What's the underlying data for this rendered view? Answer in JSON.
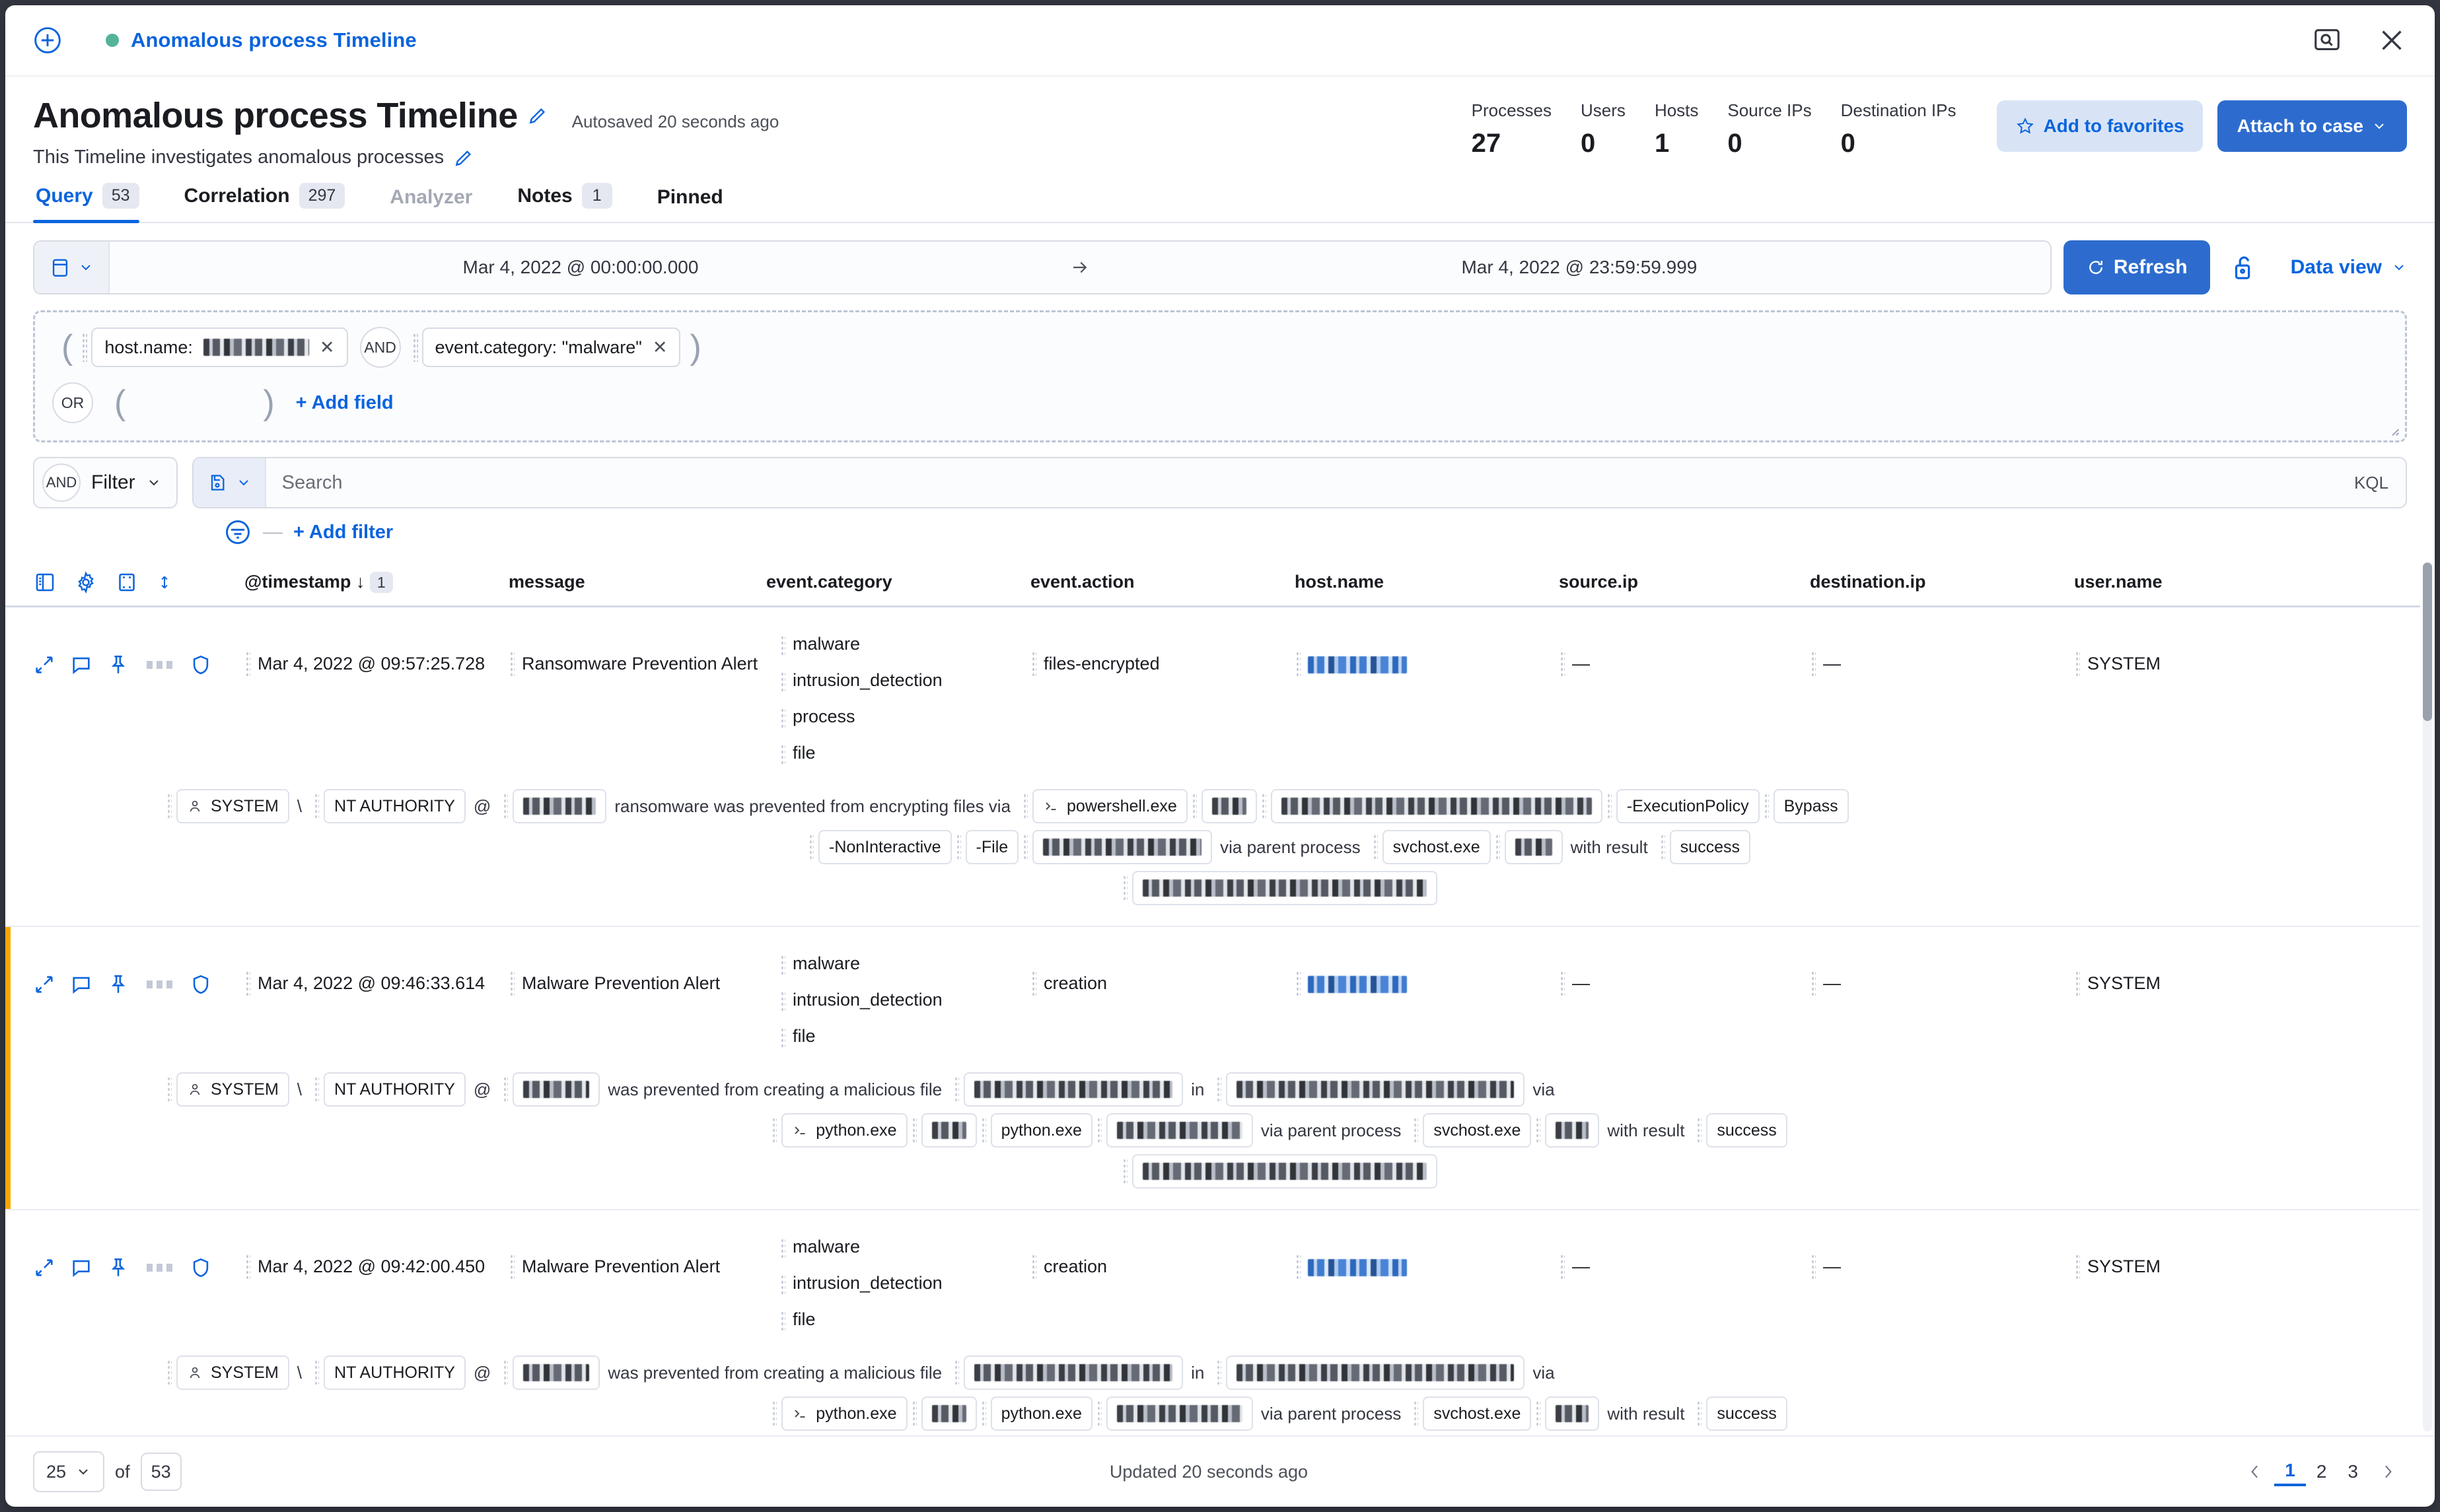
{
  "topstrip": {
    "add_icon": "plus-in-circle-icon",
    "status_dot_color": "#54b399",
    "timeline_name": "Anomalous process Timeline",
    "inspect_icon": "inspect-icon",
    "close_icon": "close-icon"
  },
  "header": {
    "title": "Anomalous process Timeline",
    "autosaved": "Autosaved 20 seconds ago",
    "description": "This Timeline investigates anomalous processes",
    "edit_icon": "pencil-icon",
    "stats": [
      {
        "label": "Processes",
        "value": "27"
      },
      {
        "label": "Users",
        "value": "0"
      },
      {
        "label": "Hosts",
        "value": "1"
      },
      {
        "label": "Source IPs",
        "value": "0"
      },
      {
        "label": "Destination IPs",
        "value": "0"
      }
    ],
    "favorites_label": "Add to favorites",
    "attach_label": "Attach to case"
  },
  "tabs": [
    {
      "label": "Query",
      "badge": "53",
      "state": "active"
    },
    {
      "label": "Correlation",
      "badge": "297",
      "state": "normal"
    },
    {
      "label": "Analyzer",
      "badge": "",
      "state": "disabled"
    },
    {
      "label": "Notes",
      "badge": "1",
      "state": "normal"
    },
    {
      "label": "Pinned",
      "badge": "",
      "state": "normal"
    }
  ],
  "toolbar": {
    "start_date": "Mar 4, 2022 @ 00:00:00.000",
    "end_date": "Mar 4, 2022 @ 23:59:59.999",
    "refresh_label": "Refresh",
    "dataview_label": "Data view",
    "calendar_icon": "calendar-icon",
    "lock_icon": "unlock-icon"
  },
  "query_builder": {
    "row1": {
      "field1_label": "host.name:",
      "field1_value_redacted": true,
      "operator": "AND",
      "field2_label": "event.category: \"malware\"",
      "remove_glyph": "✕"
    },
    "row2": {
      "operator": "OR",
      "add_field_label": "+ Add field"
    }
  },
  "filterbar": {
    "operator": "AND",
    "filter_label": "Filter",
    "search_placeholder": "Search",
    "search_value": "",
    "language_label": "KQL",
    "add_filter_label": "+ Add filter",
    "save_icon": "saved-query-icon",
    "filter_icon": "filter-icon"
  },
  "table": {
    "header_icons": [
      "columns-icon",
      "settings-gear-icon",
      "fullscreen-icon",
      "sort-icon"
    ],
    "columns": [
      {
        "key": "timestamp",
        "label": "@timestamp",
        "sort_glyph": "↓",
        "sort_badge": "1"
      },
      {
        "key": "message",
        "label": "message"
      },
      {
        "key": "event_category",
        "label": "event.category"
      },
      {
        "key": "event_action",
        "label": "event.action"
      },
      {
        "key": "host_name",
        "label": "host.name"
      },
      {
        "key": "source_ip",
        "label": "source.ip"
      },
      {
        "key": "destination_ip",
        "label": "destination.ip"
      },
      {
        "key": "user_name",
        "label": "user.name"
      }
    ],
    "rows": [
      {
        "accent": false,
        "timestamp": "Mar 4, 2022 @ 09:57:25.728",
        "message": "Ransomware Prevention Alert",
        "event_category": [
          "malware",
          "intrusion_detection",
          "process",
          "file"
        ],
        "event_action": "files-encrypted",
        "host_name_redacted": true,
        "source_ip": "—",
        "destination_ip": "—",
        "user_name": "SYSTEM",
        "detail": {
          "line1": [
            {
              "type": "pill",
              "icon": "user-icon",
              "text": "SYSTEM"
            },
            {
              "type": "text",
              "text": "\\"
            },
            {
              "type": "pill",
              "text": "NT AUTHORITY"
            },
            {
              "type": "text",
              "text": "@"
            },
            {
              "type": "pill",
              "redact": 110
            },
            {
              "type": "text",
              "text": "ransomware was prevented from encrypting files via"
            },
            {
              "type": "pill",
              "icon": "terminal-icon",
              "text": "powershell.exe"
            },
            {
              "type": "pill",
              "redact": 52
            },
            {
              "type": "pill",
              "redact": 470
            },
            {
              "type": "pill",
              "text": "-ExecutionPolicy"
            },
            {
              "type": "pill",
              "text": "Bypass"
            }
          ],
          "line2": [
            {
              "type": "pill",
              "text": "-NonInteractive"
            },
            {
              "type": "pill",
              "text": "-File"
            },
            {
              "type": "pill",
              "redact": 240
            },
            {
              "type": "text",
              "text": "via parent process"
            },
            {
              "type": "pill",
              "text": "svchost.exe"
            },
            {
              "type": "pill",
              "redact": 56
            },
            {
              "type": "text",
              "text": "with result"
            },
            {
              "type": "pill",
              "text": "success"
            }
          ],
          "line3": [
            {
              "type": "pill",
              "redact": 430
            }
          ]
        }
      },
      {
        "accent": true,
        "timestamp": "Mar 4, 2022 @ 09:46:33.614",
        "message": "Malware Prevention Alert",
        "event_category": [
          "malware",
          "intrusion_detection",
          "file"
        ],
        "event_action": "creation",
        "host_name_redacted": true,
        "source_ip": "—",
        "destination_ip": "—",
        "user_name": "SYSTEM",
        "detail": {
          "line1": [
            {
              "type": "pill",
              "icon": "user-icon",
              "text": "SYSTEM"
            },
            {
              "type": "text",
              "text": "\\"
            },
            {
              "type": "pill",
              "text": "NT AUTHORITY"
            },
            {
              "type": "text",
              "text": "@"
            },
            {
              "type": "pill",
              "redact": 100
            },
            {
              "type": "text",
              "text": "was prevented from creating a malicious file"
            },
            {
              "type": "pill",
              "redact": 300
            },
            {
              "type": "text",
              "text": "in"
            },
            {
              "type": "pill",
              "redact": 420
            },
            {
              "type": "text",
              "text": "via"
            }
          ],
          "line2": [
            {
              "type": "pill",
              "icon": "terminal-icon",
              "text": "python.exe"
            },
            {
              "type": "pill",
              "redact": 52
            },
            {
              "type": "pill",
              "text": "python.exe"
            },
            {
              "type": "pill",
              "redact": 190
            },
            {
              "type": "text",
              "text": "via parent process"
            },
            {
              "type": "pill",
              "text": "svchost.exe"
            },
            {
              "type": "pill",
              "redact": 50
            },
            {
              "type": "text",
              "text": "with result"
            },
            {
              "type": "pill",
              "text": "success"
            }
          ],
          "line3": [
            {
              "type": "pill",
              "redact": 430
            }
          ]
        }
      },
      {
        "accent": false,
        "timestamp": "Mar 4, 2022 @ 09:42:00.450",
        "message": "Malware Prevention Alert",
        "event_category": [
          "malware",
          "intrusion_detection",
          "file"
        ],
        "event_action": "creation",
        "host_name_redacted": true,
        "source_ip": "—",
        "destination_ip": "—",
        "user_name": "SYSTEM",
        "detail": {
          "line1": [
            {
              "type": "pill",
              "icon": "user-icon",
              "text": "SYSTEM"
            },
            {
              "type": "text",
              "text": "\\"
            },
            {
              "type": "pill",
              "text": "NT AUTHORITY"
            },
            {
              "type": "text",
              "text": "@"
            },
            {
              "type": "pill",
              "redact": 100
            },
            {
              "type": "text",
              "text": "was prevented from creating a malicious file"
            },
            {
              "type": "pill",
              "redact": 300
            },
            {
              "type": "text",
              "text": "in"
            },
            {
              "type": "pill",
              "redact": 420
            },
            {
              "type": "text",
              "text": "via"
            }
          ],
          "line2": [
            {
              "type": "pill",
              "icon": "terminal-icon",
              "text": "python.exe"
            },
            {
              "type": "pill",
              "redact": 52
            },
            {
              "type": "pill",
              "text": "python.exe"
            },
            {
              "type": "pill",
              "redact": 190
            },
            {
              "type": "text",
              "text": "via parent process"
            },
            {
              "type": "pill",
              "text": "svchost.exe"
            },
            {
              "type": "pill",
              "redact": 50
            },
            {
              "type": "text",
              "text": "with result"
            },
            {
              "type": "pill",
              "text": "success"
            }
          ],
          "line3": [
            {
              "type": "pill",
              "redact": 430
            }
          ]
        }
      }
    ]
  },
  "footer": {
    "per_page": "25",
    "of_label": "of",
    "total": "53",
    "updated": "Updated 20 seconds ago",
    "pages": [
      "1",
      "2",
      "3"
    ],
    "active_page": "1"
  }
}
